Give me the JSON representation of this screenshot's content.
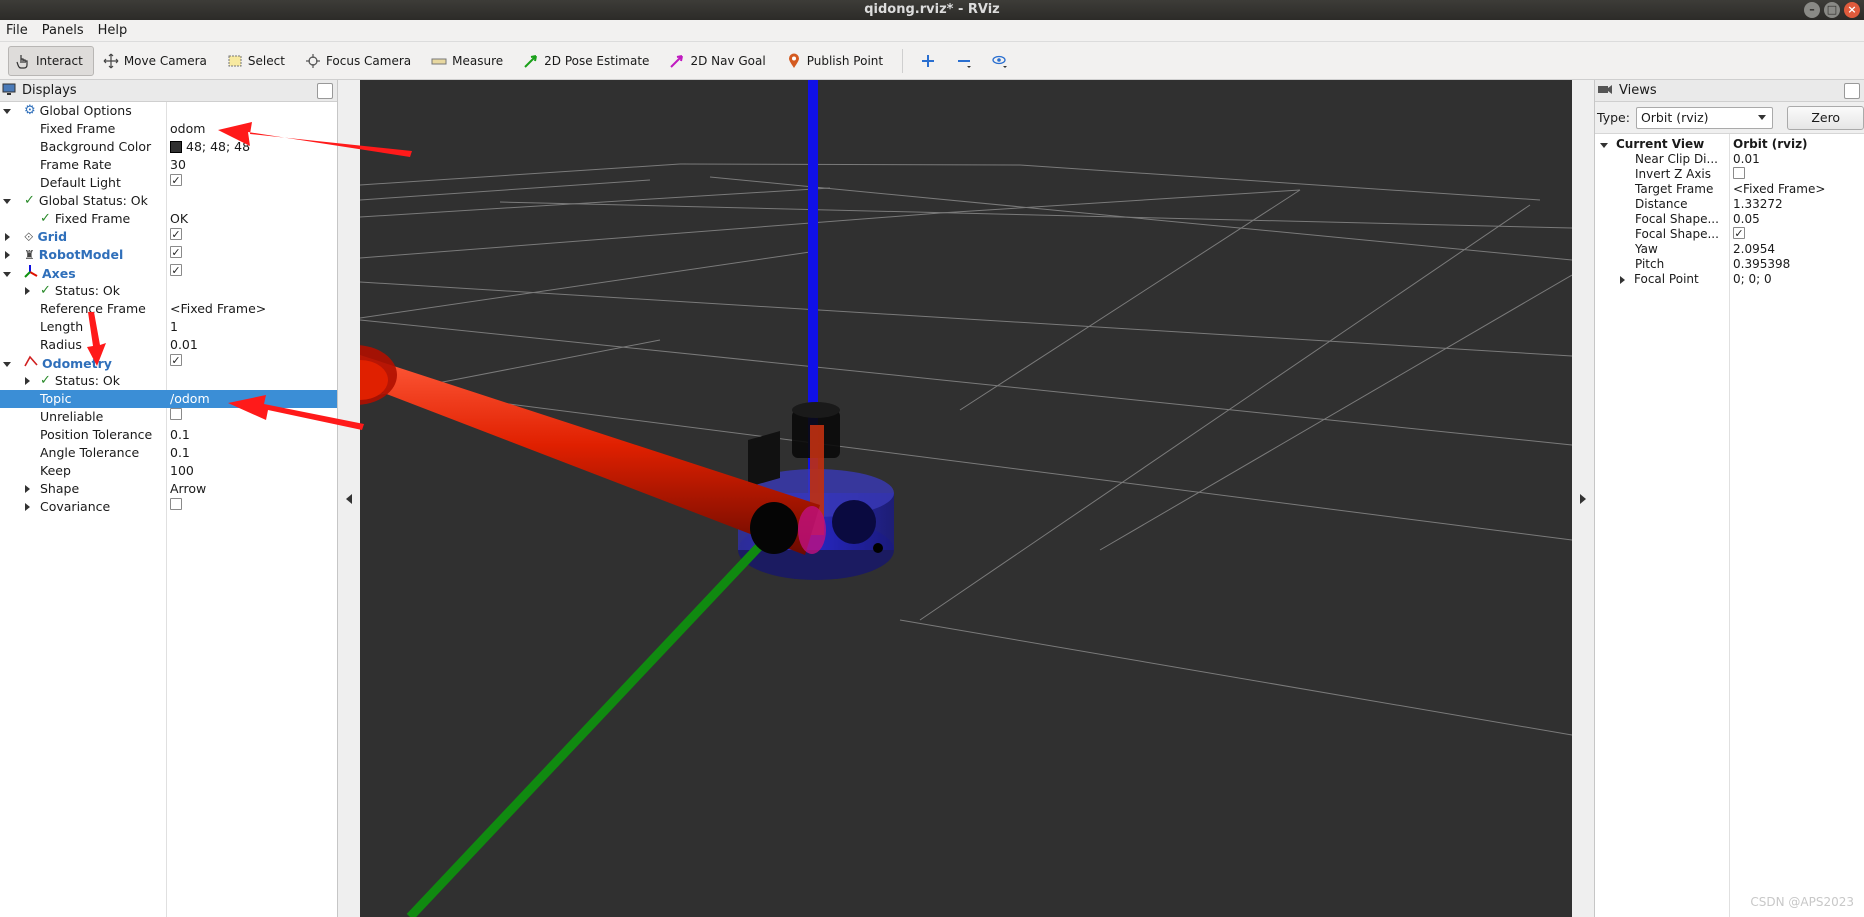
{
  "window": {
    "title": "qidong.rviz* - RViz"
  },
  "menu": {
    "file": "File",
    "panels": "Panels",
    "help": "Help"
  },
  "toolbar": {
    "interact": "Interact",
    "move_camera": "Move Camera",
    "select": "Select",
    "focus_camera": "Focus Camera",
    "measure": "Measure",
    "pose_estimate": "2D Pose Estimate",
    "nav_goal": "2D Nav Goal",
    "publish_point": "Publish Point"
  },
  "displays": {
    "header": "Displays",
    "global_options": "Global Options",
    "fixed_frame_label": "Fixed Frame",
    "fixed_frame_value": "odom",
    "background_color_label": "Background Color",
    "background_color_value": "48; 48; 48",
    "frame_rate_label": "Frame Rate",
    "frame_rate_value": "30",
    "default_light_label": "Default Light",
    "global_status": "Global Status: Ok",
    "gs_fixed_frame_label": "Fixed Frame",
    "gs_fixed_frame_value": "OK",
    "grid": "Grid",
    "robot_model": "RobotModel",
    "axes": "Axes",
    "axes_status": "Status: Ok",
    "reference_frame_label": "Reference Frame",
    "reference_frame_value": "<Fixed Frame>",
    "length_label": "Length",
    "length_value": "1",
    "radius_label": "Radius",
    "radius_value": "0.01",
    "odometry": "Odometry",
    "odom_status": "Status: Ok",
    "topic_label": "Topic",
    "topic_value": "/odom",
    "unreliable_label": "Unreliable",
    "position_tolerance_label": "Position Tolerance",
    "position_tolerance_value": "0.1",
    "angle_tolerance_label": "Angle Tolerance",
    "angle_tolerance_value": "0.1",
    "keep_label": "Keep",
    "keep_value": "100",
    "shape_label": "Shape",
    "shape_value": "Arrow",
    "covariance_label": "Covariance"
  },
  "views": {
    "header": "Views",
    "type_label": "Type:",
    "type_value": "Orbit (rviz)",
    "zero": "Zero",
    "current_view": "Current View",
    "current_view_value": "Orbit (rviz)",
    "near_clip_label": "Near Clip Di...",
    "near_clip_value": "0.01",
    "invert_z_label": "Invert Z Axis",
    "target_frame_label": "Target Frame",
    "target_frame_value": "<Fixed Frame>",
    "distance_label": "Distance",
    "distance_value": "1.33272",
    "focal_shape_size_label": "Focal Shape...",
    "focal_shape_size_value": "0.05",
    "focal_shape_fixed_label": "Focal Shape...",
    "yaw_label": "Yaw",
    "yaw_value": "2.0954",
    "pitch_label": "Pitch",
    "pitch_value": "0.395398",
    "focal_point_label": "Focal Point",
    "focal_point_value": "0; 0; 0"
  },
  "watermark": "CSDN @APS2023",
  "colors": {
    "viewport_bg": "#303030",
    "selection": "#3b8ed6",
    "annotation_arrow": "#ff1a1a",
    "axis_x": "#e01000",
    "axis_y": "#109010",
    "axis_z": "#1010e0"
  }
}
